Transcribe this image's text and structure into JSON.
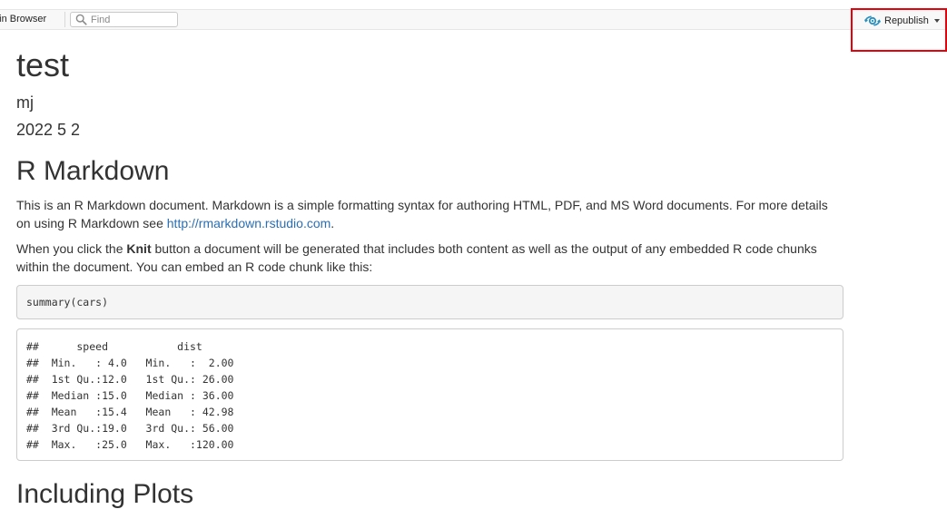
{
  "toolbar": {
    "open_in_browser_label": "n in Browser",
    "find_placeholder": "Find",
    "find_value": "",
    "republish_label": "Republish",
    "icons": {
      "find": "search-icon",
      "republish": "rpubs-publish-icon",
      "dropdown": "caret-down-icon"
    },
    "accent_color": "#2a8fbd",
    "highlight_color": "#e8000b"
  },
  "document": {
    "title": "test",
    "author": "mj",
    "date": "2022 5 2",
    "section1": {
      "heading": "R Markdown",
      "para1_text": "This is an R Markdown document. Markdown is a simple formatting syntax for authoring HTML, PDF, and MS Word documents. For more details on using R Markdown see ",
      "para1_link": "http://rmarkdown.rstudio.com",
      "para1_end": ".",
      "para2_before": "When you click the ",
      "para2_bold": "Knit",
      "para2_after": " button a document will be generated that includes both content as well as the output of any embedded R code chunks within the document. You can embed an R code chunk like this:",
      "code": "summary(cars)",
      "output_lines": [
        "##      speed           dist       ",
        "##  Min.   : 4.0   Min.   :  2.00  ",
        "##  1st Qu.:12.0   1st Qu.: 26.00  ",
        "##  Median :15.0   Median : 36.00  ",
        "##  Mean   :15.4   Mean   : 42.98  ",
        "##  3rd Qu.:19.0   3rd Qu.: 56.00  ",
        "##  Max.   :25.0   Max.   :120.00  "
      ]
    },
    "section2": {
      "heading": "Including Plots"
    },
    "link_color": "#2a6fb4"
  }
}
